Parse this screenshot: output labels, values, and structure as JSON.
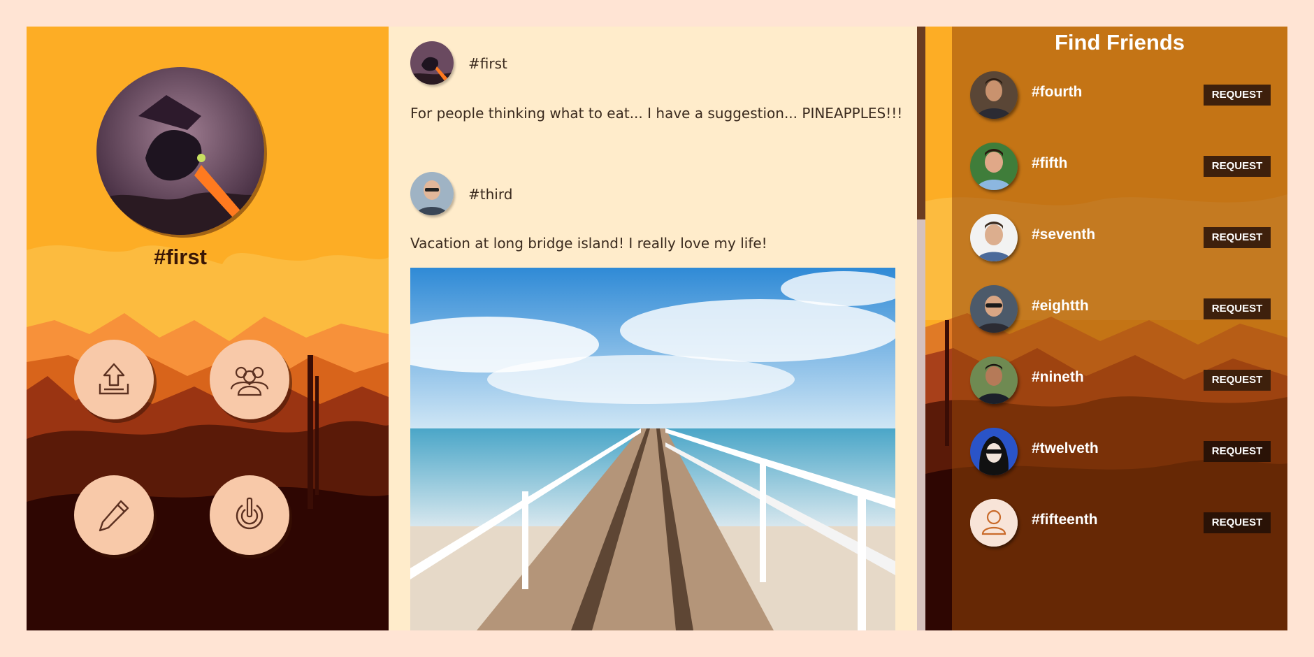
{
  "profile": {
    "name": "#first",
    "actions": [
      {
        "name": "upload-button",
        "icon": "upload-icon"
      },
      {
        "name": "friends-button",
        "icon": "group-icon"
      },
      {
        "name": "edit-button",
        "icon": "pencil-icon"
      },
      {
        "name": "logout-button",
        "icon": "power-icon"
      }
    ]
  },
  "feed": {
    "posts": [
      {
        "author": "#first",
        "text": "For people thinking what to eat... I have a suggestion... PINEAPPLES!!!"
      },
      {
        "author": "#third",
        "text": "Vacation at long bridge island! I really love my life!"
      }
    ]
  },
  "friends": {
    "title": "Find Friends",
    "request_label": "REQUEST",
    "items": [
      {
        "name": "#fourth"
      },
      {
        "name": "#fifth"
      },
      {
        "name": "#seventh"
      },
      {
        "name": "#eightth"
      },
      {
        "name": "#nineth"
      },
      {
        "name": "#twelveth"
      },
      {
        "name": "#fifteenth"
      }
    ]
  },
  "colors": {
    "page_bg": "#ffe4d4",
    "feed_bg": "#ffeccb",
    "sky": "#fdad25",
    "button_bg": "#f8c9a9",
    "request_bg": "#3e200c",
    "scroll_thumb": "#6b3c22"
  }
}
